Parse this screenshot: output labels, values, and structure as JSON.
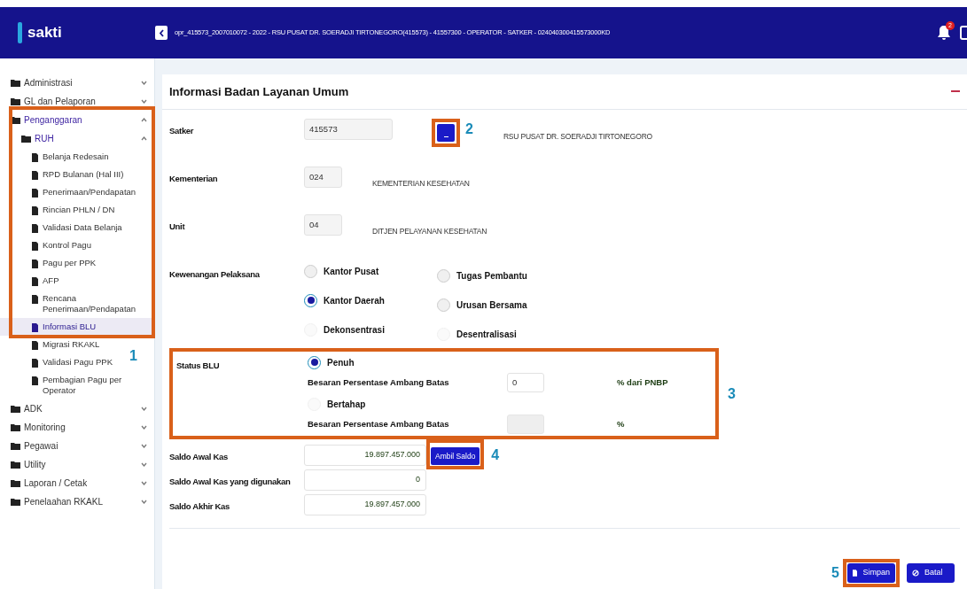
{
  "header": {
    "logo": "sakti",
    "session": "opr_415573_2007010072 - 2022 - RSU PUSAT DR. SOERADJI TIRTONEGORO(415573) - 41557300 - OPERATOR - SATKER - 024040300415573000KD",
    "notification_count": "2"
  },
  "sidebar": [
    {
      "label": "Administrasi",
      "kind": "folder",
      "expanded": false
    },
    {
      "label": "GL dan Pelaporan",
      "kind": "folder",
      "expanded": false
    },
    {
      "label": "Penganggaran",
      "kind": "folder",
      "expanded": true,
      "children": [
        {
          "label": "RUH",
          "kind": "folder",
          "expanded": true,
          "children": [
            {
              "label": "Belanja Redesain",
              "kind": "page",
              "selected": false
            },
            {
              "label": "RPD Bulanan (Hal III)",
              "kind": "page",
              "selected": false
            },
            {
              "label": "Penerimaan/Pendapatan",
              "kind": "page",
              "selected": false
            },
            {
              "label": "Rincian PHLN / DN",
              "kind": "page",
              "selected": false
            },
            {
              "label": "Validasi Data Belanja",
              "kind": "page",
              "selected": false
            },
            {
              "label": "Kontrol Pagu",
              "kind": "page",
              "selected": false
            },
            {
              "label": "Pagu per PPK",
              "kind": "page",
              "selected": false
            },
            {
              "label": "AFP",
              "kind": "page",
              "selected": false
            },
            {
              "label": "Rencana Penerimaan/Pendapatan",
              "kind": "page",
              "selected": false
            },
            {
              "label": "Informasi BLU",
              "kind": "page",
              "selected": true
            },
            {
              "label": "Migrasi RKAKL",
              "kind": "page",
              "selected": false
            },
            {
              "label": "Validasi Pagu PPK",
              "kind": "page",
              "selected": false
            },
            {
              "label": "Pembagian Pagu per Operator",
              "kind": "page",
              "selected": false
            }
          ]
        }
      ]
    },
    {
      "label": "ADK",
      "kind": "folder",
      "expanded": false
    },
    {
      "label": "Monitoring",
      "kind": "folder",
      "expanded": false
    },
    {
      "label": "Pegawai",
      "kind": "folder",
      "expanded": false
    },
    {
      "label": "Utility",
      "kind": "folder",
      "expanded": false
    },
    {
      "label": "Laporan / Cetak",
      "kind": "folder",
      "expanded": false
    },
    {
      "label": "Penelaahan RKAKL",
      "kind": "folder",
      "expanded": false
    }
  ],
  "form": {
    "title": "Informasi Badan Layanan Umum",
    "fields": [
      {
        "label": "Satker",
        "value": "415573",
        "wide": true,
        "lookup": true,
        "description": "RSU PUSAT DR. SOERADJI TIRTONEGORO"
      },
      {
        "label": "Kementerian",
        "value": "024",
        "wide": false,
        "lookup": false,
        "description": "KEMENTERIAN KESEHATAN"
      },
      {
        "label": "Unit",
        "value": "04",
        "wide": false,
        "lookup": false,
        "description": "DITJEN PELAYANAN KESEHATAN"
      }
    ],
    "kewenangan": {
      "label": "Kewenangan Pelaksana",
      "options": [
        {
          "label": "Kantor Pusat",
          "selected": false,
          "disabled": false
        },
        {
          "label": "Kantor Daerah",
          "selected": true,
          "disabled": false
        },
        {
          "label": "Dekonsentrasi",
          "selected": false,
          "disabled": true
        },
        {
          "label": "Tugas Pembantu",
          "selected": false,
          "disabled": false
        },
        {
          "label": "Urusan Bersama",
          "selected": false,
          "disabled": false
        },
        {
          "label": "Desentralisasi",
          "selected": false,
          "disabled": true
        }
      ]
    },
    "status_blu": {
      "label": "Status BLU",
      "options": [
        {
          "label": "Penuh",
          "selected": true,
          "threshold_label": "Besaran Persentase Ambang Batas",
          "value": "0",
          "unit": "% dari PNBP",
          "disabled": false
        },
        {
          "label": "Bertahap",
          "selected": false,
          "threshold_label": "Besaran Persentase Ambang Batas",
          "unit": "%",
          "disabled": true
        }
      ]
    },
    "saldo": [
      {
        "label": "Saldo Awal Kas",
        "value": "19.897.457.000",
        "button": "Ambil Saldo"
      },
      {
        "label": "Saldo Awal Kas yang digunakan",
        "value": "0"
      },
      {
        "label": "Saldo Akhir Kas",
        "value": "19.897.457.000"
      }
    ],
    "actions": [
      {
        "label": "Simpan",
        "kind": "save"
      },
      {
        "label": "Batal",
        "kind": "cancel"
      }
    ]
  },
  "annotations": [
    {
      "label": "1"
    },
    {
      "label": "2"
    },
    {
      "label": "3"
    },
    {
      "label": "4"
    },
    {
      "label": "5"
    }
  ]
}
